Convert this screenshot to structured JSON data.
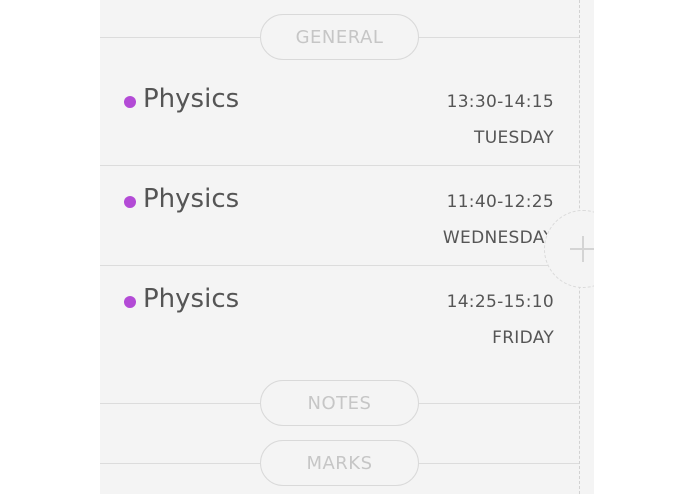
{
  "sections": {
    "general": "GENERAL",
    "notes": "NOTES",
    "marks": "MARKS"
  },
  "lessons": [
    {
      "subject": "Physics",
      "time": "13:30-14:15",
      "day": "TUESDAY"
    },
    {
      "subject": "Physics",
      "time": "11:40-12:25",
      "day": "WEDNESDAY"
    },
    {
      "subject": "Physics",
      "time": "14:25-15:10",
      "day": "FRIDAY"
    }
  ],
  "colors": {
    "accent": "#b34bd6",
    "panel_bg": "#f4f4f4"
  },
  "icons": {
    "add": "plus-icon"
  }
}
